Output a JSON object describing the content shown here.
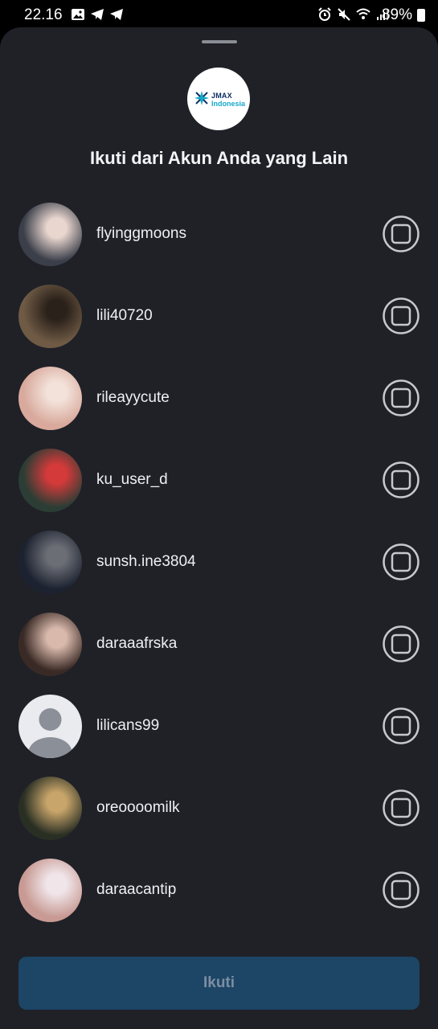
{
  "status_bar": {
    "time": "22.16",
    "battery_percent": "89%"
  },
  "header": {
    "logo_text_line1": "JMAX",
    "logo_text_line2": "Indonesia",
    "title": "Ikuti dari Akun Anda yang Lain"
  },
  "accounts": [
    {
      "username": "flyinggmoons",
      "selected": false,
      "avatar_palette": [
        "#3b3f4a",
        "#e9d6cf"
      ]
    },
    {
      "username": "lili40720",
      "selected": false,
      "avatar_palette": [
        "#6f5a45",
        "#2a211a"
      ]
    },
    {
      "username": "rileayycute",
      "selected": false,
      "avatar_palette": [
        "#d8a99c",
        "#f3e2da"
      ]
    },
    {
      "username": "ku_user_d",
      "selected": false,
      "avatar_palette": [
        "#2b3d34",
        "#d43a3a"
      ]
    },
    {
      "username": "sunsh.ine3804",
      "selected": false,
      "avatar_palette": [
        "#1c2230",
        "#6b6e75"
      ]
    },
    {
      "username": "daraaafrska",
      "selected": false,
      "avatar_palette": [
        "#3a2a25",
        "#d9b9ac"
      ]
    },
    {
      "username": "lilicans99",
      "selected": false,
      "avatar_palette": [
        "#e9ebee",
        "#8a8f98"
      ],
      "default_avatar": true
    },
    {
      "username": "oreoooomilk",
      "selected": false,
      "avatar_palette": [
        "#2a2f24",
        "#c8a56a"
      ]
    },
    {
      "username": "daraacantip",
      "selected": false,
      "avatar_palette": [
        "#c89a93",
        "#f0e6ea"
      ]
    }
  ],
  "footer": {
    "follow_label": "Ikuti"
  },
  "colors": {
    "sheet_background": "#1f2127",
    "button_disabled_bg": "#1c4566",
    "button_disabled_text": "#7c8ea2",
    "checkbox_stroke": "#c6c8cc"
  }
}
